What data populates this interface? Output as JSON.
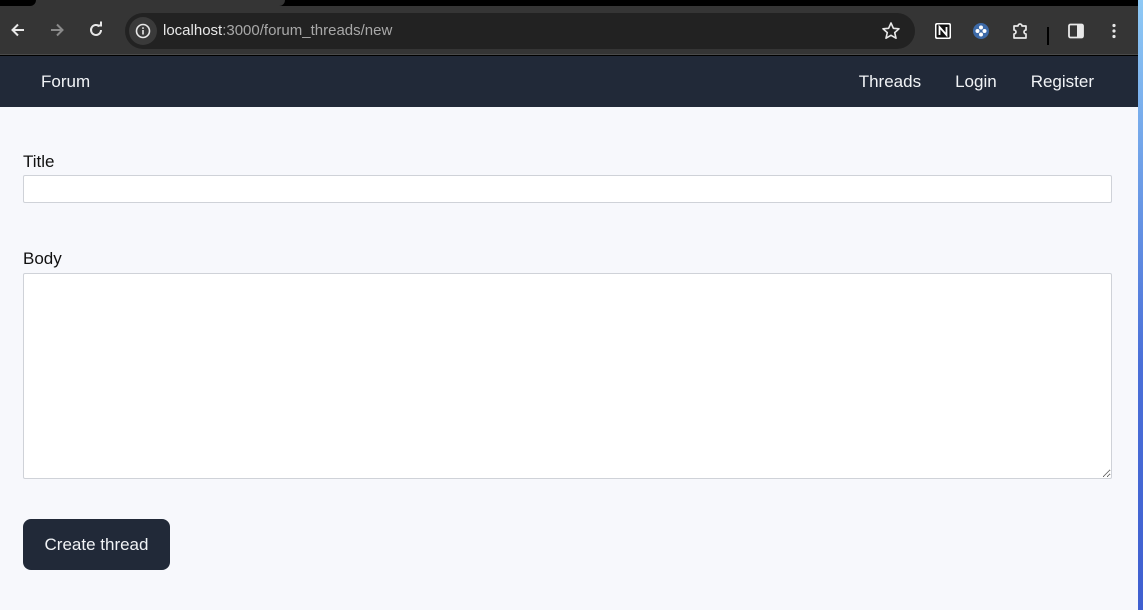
{
  "browser": {
    "url_host": "localhost",
    "url_rest": ":3000/forum_threads/new",
    "icons": {
      "back": "arrow-left-icon",
      "forward": "arrow-right-icon",
      "reload": "reload-icon",
      "site_info": "info-icon",
      "bookmark": "star-icon",
      "notion_ext": "notion-icon",
      "ext2": "extension-dots-icon",
      "extensions": "puzzle-icon",
      "side_panel": "side-panel-icon",
      "menu": "kebab-menu-icon"
    }
  },
  "navbar": {
    "brand": "Forum",
    "links": [
      "Threads",
      "Login",
      "Register"
    ]
  },
  "form": {
    "title_label": "Title",
    "title_value": "",
    "body_label": "Body",
    "body_value": "",
    "submit_label": "Create thread"
  },
  "colors": {
    "navbar_bg": "#212938",
    "page_bg": "#f7f8fc",
    "button_bg": "#212938"
  }
}
